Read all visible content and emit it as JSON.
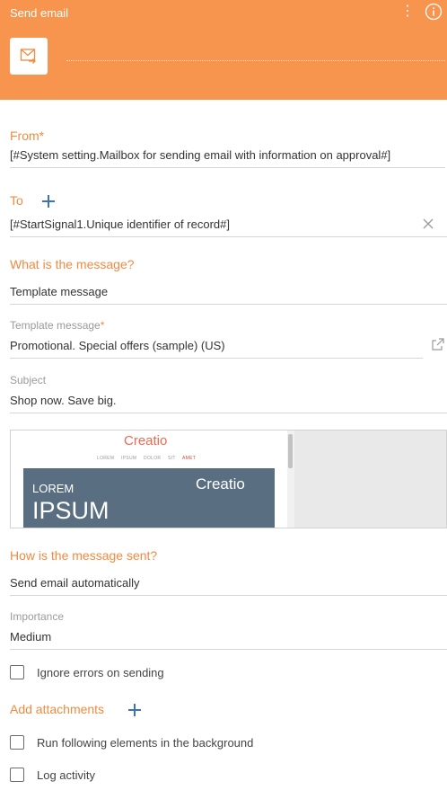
{
  "header": {
    "title": "Send email",
    "menu_icon": "⋮",
    "info_icon": "info-icon",
    "element_icon": "email-icon"
  },
  "from": {
    "label": "From",
    "required_mark": "*",
    "value": "[#System setting.Mailbox for sending email with information on approval#]"
  },
  "to": {
    "label": "To",
    "value": "[#StartSignal1.Unique identifier of record#]"
  },
  "message": {
    "title": "What is the message?",
    "type_value": "Template message",
    "template_label": "Template message",
    "template_required": "*",
    "template_value": "Promotional. Special offers (sample) (US)",
    "subject_label": "Subject",
    "subject_value": "Shop now. Save big."
  },
  "preview": {
    "logo": "Creatio",
    "nav_items": [
      "LOREM",
      "IPSUM",
      "DOLOR",
      "SIT"
    ],
    "nav_highlight": "AMET",
    "banner_small": "LOREM",
    "banner_big": "IPSUM",
    "banner_logo": "Creatio"
  },
  "sending": {
    "title": "How is the message sent?",
    "mode_value": "Send email automatically",
    "importance_label": "Importance",
    "importance_value": "Medium",
    "ignore_errors_label": "Ignore errors on sending"
  },
  "attachments": {
    "title": "Add attachments"
  },
  "options": {
    "background_label": "Run following elements in the background",
    "log_activity_label": "Log activity"
  },
  "colors": {
    "header": "#f7954f",
    "accent": "#f28a3f",
    "link": "#3a73b8"
  }
}
